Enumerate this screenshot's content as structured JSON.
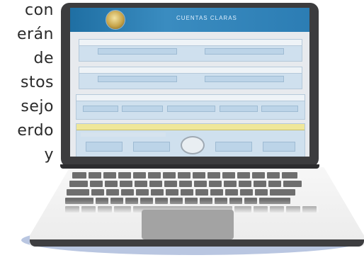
{
  "text_fragments": [
    "con",
    "erán",
    "de",
    "stos",
    "sejo",
    "erdo",
    "y"
  ],
  "website": {
    "title": "CUENTAS CLARAS"
  }
}
